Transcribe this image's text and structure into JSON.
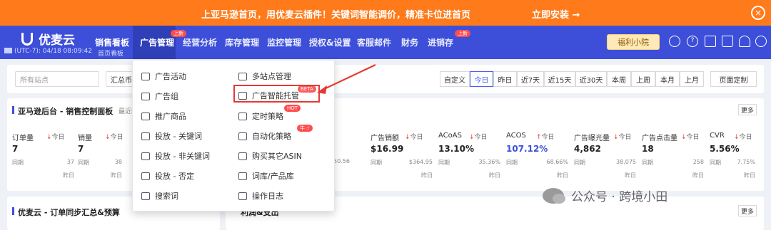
{
  "banner": {
    "message": "上亚马逊首页，用优麦云插件！关键词智能调价，精准卡位进首页",
    "cta": "立即安装 →",
    "close": "×"
  },
  "brand": {
    "name": "优麦云",
    "clock": "(UTC-7): 04/18 08:09:42"
  },
  "nav": {
    "items": [
      "销售看板",
      "广告管理",
      "经营分析",
      "库存管理",
      "监控管理",
      "授权&设置",
      "客服邮件",
      "财务",
      "进销存"
    ],
    "sub_label": "首页看板",
    "tag_ads": "上新",
    "tag_erp": "上新",
    "welfare": "福利小院",
    "icons": [
      "headset-icon",
      "help-icon",
      "shop-icon",
      "cart-icon",
      "bell-icon",
      "user-icon",
      "more-icon"
    ]
  },
  "filters": {
    "site_placeholder": "所有站点",
    "currency": "汇总币"
  },
  "ranges": [
    "自定义",
    "今日",
    "昨日",
    "近7天",
    "近15天",
    "近30天",
    "本周",
    "上周",
    "本月",
    "上月",
    "页面定制"
  ],
  "dashboard": {
    "title": "亚马逊后台 - 销售控制面板",
    "hint": "最近的",
    "more": "更多"
  },
  "metrics": [
    {
      "label": "订单量",
      "change": "↓",
      "period": "今日",
      "value": "7",
      "prev_label": "同期",
      "prev": "37",
      "yest": "昨日"
    },
    {
      "label": "销量",
      "change": "↓",
      "period": "今日",
      "value": "7",
      "prev_label": "同期",
      "prev": "38",
      "yest": "昨日"
    },
    {
      "label": "广告销额",
      "change": "↓",
      "period": "今日",
      "value": "$16.99",
      "prev_label": "同期",
      "prev": "$364.95",
      "yest": "昨日"
    },
    {
      "label": "ACoAS",
      "change": "↓",
      "period": "今日",
      "value": "13.10%",
      "prev_label": "同期",
      "prev": "35.36%",
      "yest": "昨日"
    },
    {
      "label": "ACOS",
      "change": "↑",
      "period": "今日",
      "value": "107.12%",
      "prev_label": "同期",
      "prev": "68.66%",
      "yest": "昨日"
    },
    {
      "label": "广告曝光量",
      "change": "↓",
      "period": "今日",
      "value": "4,862",
      "prev_label": "同期",
      "prev": "38,075",
      "yest": "昨日"
    },
    {
      "label": "广告点击量",
      "change": "↓",
      "period": "今日",
      "value": "18",
      "prev_label": "同期",
      "prev": "258",
      "yest": "昨日"
    },
    {
      "label": "CVR",
      "change": "↓",
      "period": "今日",
      "value": "5.56%",
      "prev_label": "同期",
      "prev": "7.75%",
      "yest": "昨日"
    }
  ],
  "partial_prev": "50.56",
  "bottom": {
    "title": "优麦云 - 订单同步汇总&预算",
    "right_title": "利润&支出",
    "more": "更多"
  },
  "dropdown": {
    "left": [
      "广告活动",
      "广告组",
      "推广商品",
      "投放 - 关键词",
      "投放 - 非关键词",
      "投放 - 否定",
      "搜索词"
    ],
    "right": [
      "多站点管理",
      "广告智能托管",
      "定时策略",
      "自动化策略",
      "购买其它ASIN",
      "词库/产品库",
      "操作日志"
    ],
    "tags": {
      "beta": "BETA",
      "hot": "HOT",
      "new": "牛 ☝"
    }
  },
  "watermark": "公众号 · 跨境小田"
}
